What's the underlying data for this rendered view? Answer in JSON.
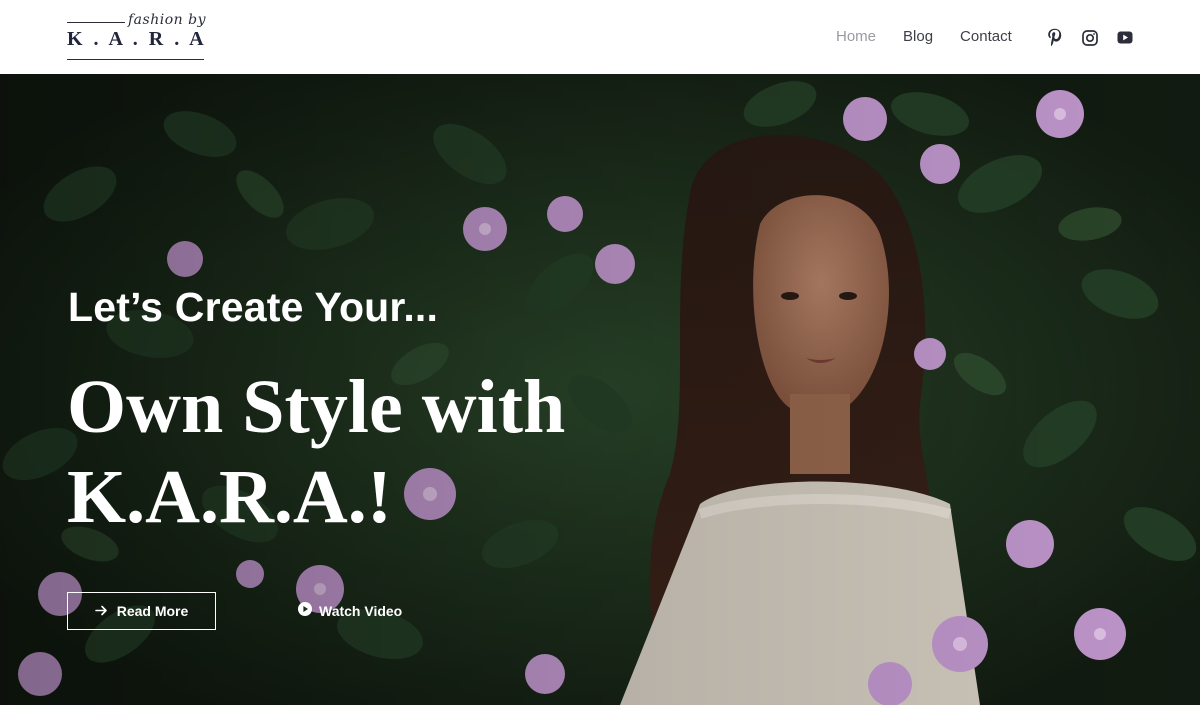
{
  "logo": {
    "script_text": "fashion by",
    "brand_text": "K . A . R . A"
  },
  "nav": {
    "items": [
      {
        "label": "Home",
        "active": true
      },
      {
        "label": "Blog",
        "active": false
      },
      {
        "label": "Contact",
        "active": false
      }
    ]
  },
  "social": {
    "icons": [
      "pinterest-icon",
      "instagram-icon",
      "youtube-icon"
    ]
  },
  "hero": {
    "kicker": "Let’s Create Your...",
    "title": "Own Style with K.A.R.A.!",
    "read_more_label": "Read More",
    "watch_video_label": "Watch Video"
  },
  "colors": {
    "text_dark": "#2b2e3a",
    "nav_active": "#9a9aa3",
    "hero_text": "#ffffff",
    "foliage": "#1f3a22",
    "flower": "#c9a0d6"
  }
}
